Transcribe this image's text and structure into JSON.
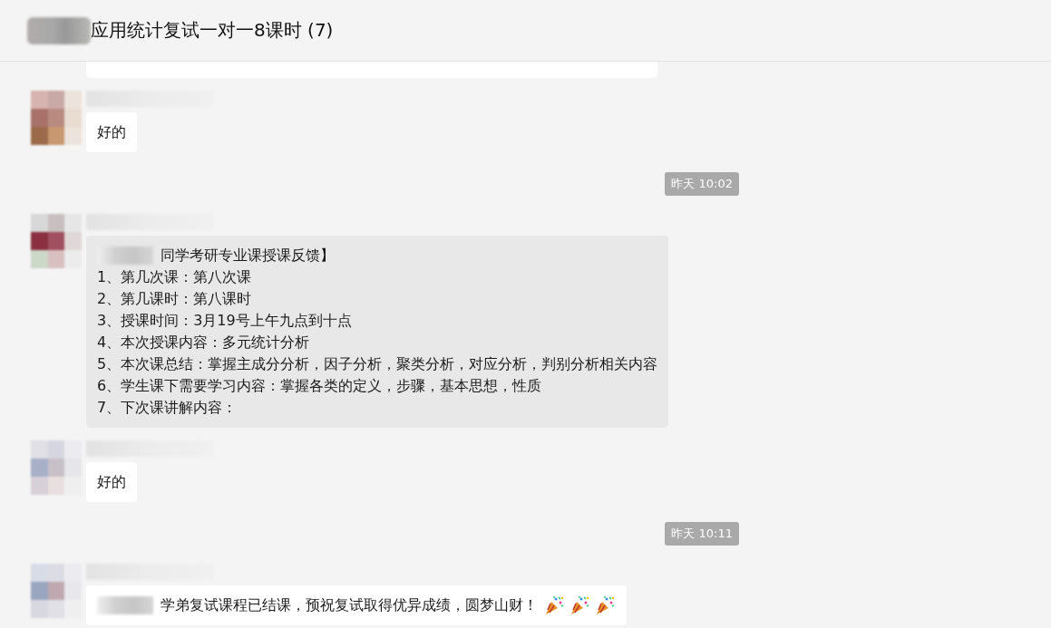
{
  "header": {
    "title": "应用统计复试一对一8课时 (7)"
  },
  "messages": [
    {
      "kind": "fragment"
    },
    {
      "kind": "message",
      "highlighted": false,
      "lines": [
        {
          "redacted": false,
          "text": "好的"
        }
      ]
    },
    {
      "kind": "time",
      "text": "昨天 10:02"
    },
    {
      "kind": "message",
      "highlighted": true,
      "lines": [
        {
          "redacted": true,
          "text": "同学考研专业课授课反馈】"
        },
        {
          "redacted": false,
          "text": "1、第几次课：第八次课"
        },
        {
          "redacted": false,
          "text": "2、第几课时：第八课时"
        },
        {
          "redacted": false,
          "text": "3、授课时间：3月19号上午九点到十点"
        },
        {
          "redacted": false,
          "text": "4、本次授课内容：多元统计分析"
        },
        {
          "redacted": false,
          "text": "5、本次课总结：掌握主成分分析，因子分析，聚类分析，对应分析，判别分析相关内容"
        },
        {
          "redacted": false,
          "text": "6、学生课下需要学习内容：掌握各类的定义，步骤，基本思想，性质"
        },
        {
          "redacted": false,
          "text": "7、下次课讲解内容："
        }
      ]
    },
    {
      "kind": "message",
      "highlighted": false,
      "lines": [
        {
          "redacted": false,
          "text": "好的"
        }
      ]
    },
    {
      "kind": "time",
      "text": "昨天 10:11"
    },
    {
      "kind": "message",
      "highlighted": false,
      "lines": [
        {
          "redacted": true,
          "text": "学弟复试课程已结课，预祝复试取得优异成绩，圆梦山财！"
        }
      ],
      "emojis": [
        {
          "kind": "party-popper"
        },
        {
          "kind": "party-popper"
        },
        {
          "kind": "party-popper"
        }
      ]
    }
  ]
}
